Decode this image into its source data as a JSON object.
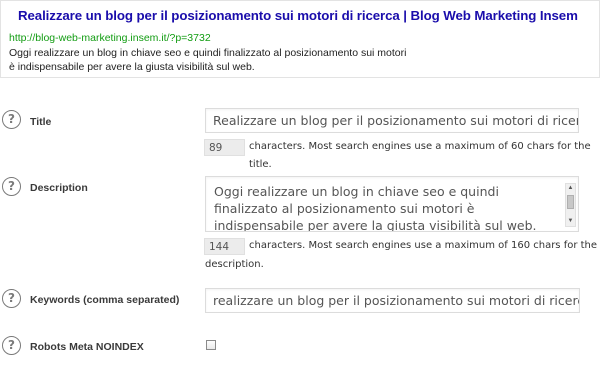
{
  "snippet_preview": {
    "title": "Realizzare un blog per il posizionamento sui motori di ricerca | Blog Web Marketing Insem",
    "url": "http://blog-web-marketing.insem.it/?p=3732",
    "description": "Oggi realizzare un blog in chiave seo e quindi finalizzato al posizionamento sui motori è indispensabile per avere la giusta visibilità sul web."
  },
  "fields": {
    "title": {
      "label": "Title",
      "value": "Realizzare un blog per il posizionamento sui motori di ricerca",
      "char_count": "89",
      "char_note": "characters. Most search engines use a maximum of 60 chars for the title."
    },
    "description": {
      "label": "Description",
      "value": "Oggi realizzare un blog in chiave seo e quindi finalizzato al posizionamento sui motori è indispensabile per avere la giusta visibilità sul web.",
      "char_count": "144",
      "char_note_line1": "characters. Most search engines use a maximum of 160 chars for the",
      "char_note_line2": "description."
    },
    "keywords": {
      "label": "Keywords (comma separated)",
      "value": "realizzare un blog per il posizionamento sui motori di ricerca, posiziona"
    },
    "noindex": {
      "label": "Robots Meta NOINDEX",
      "checked": false
    }
  },
  "help_icon_glyph": "?",
  "colors": {
    "preview_title": "#1a0dab",
    "preview_url": "#129c12"
  }
}
